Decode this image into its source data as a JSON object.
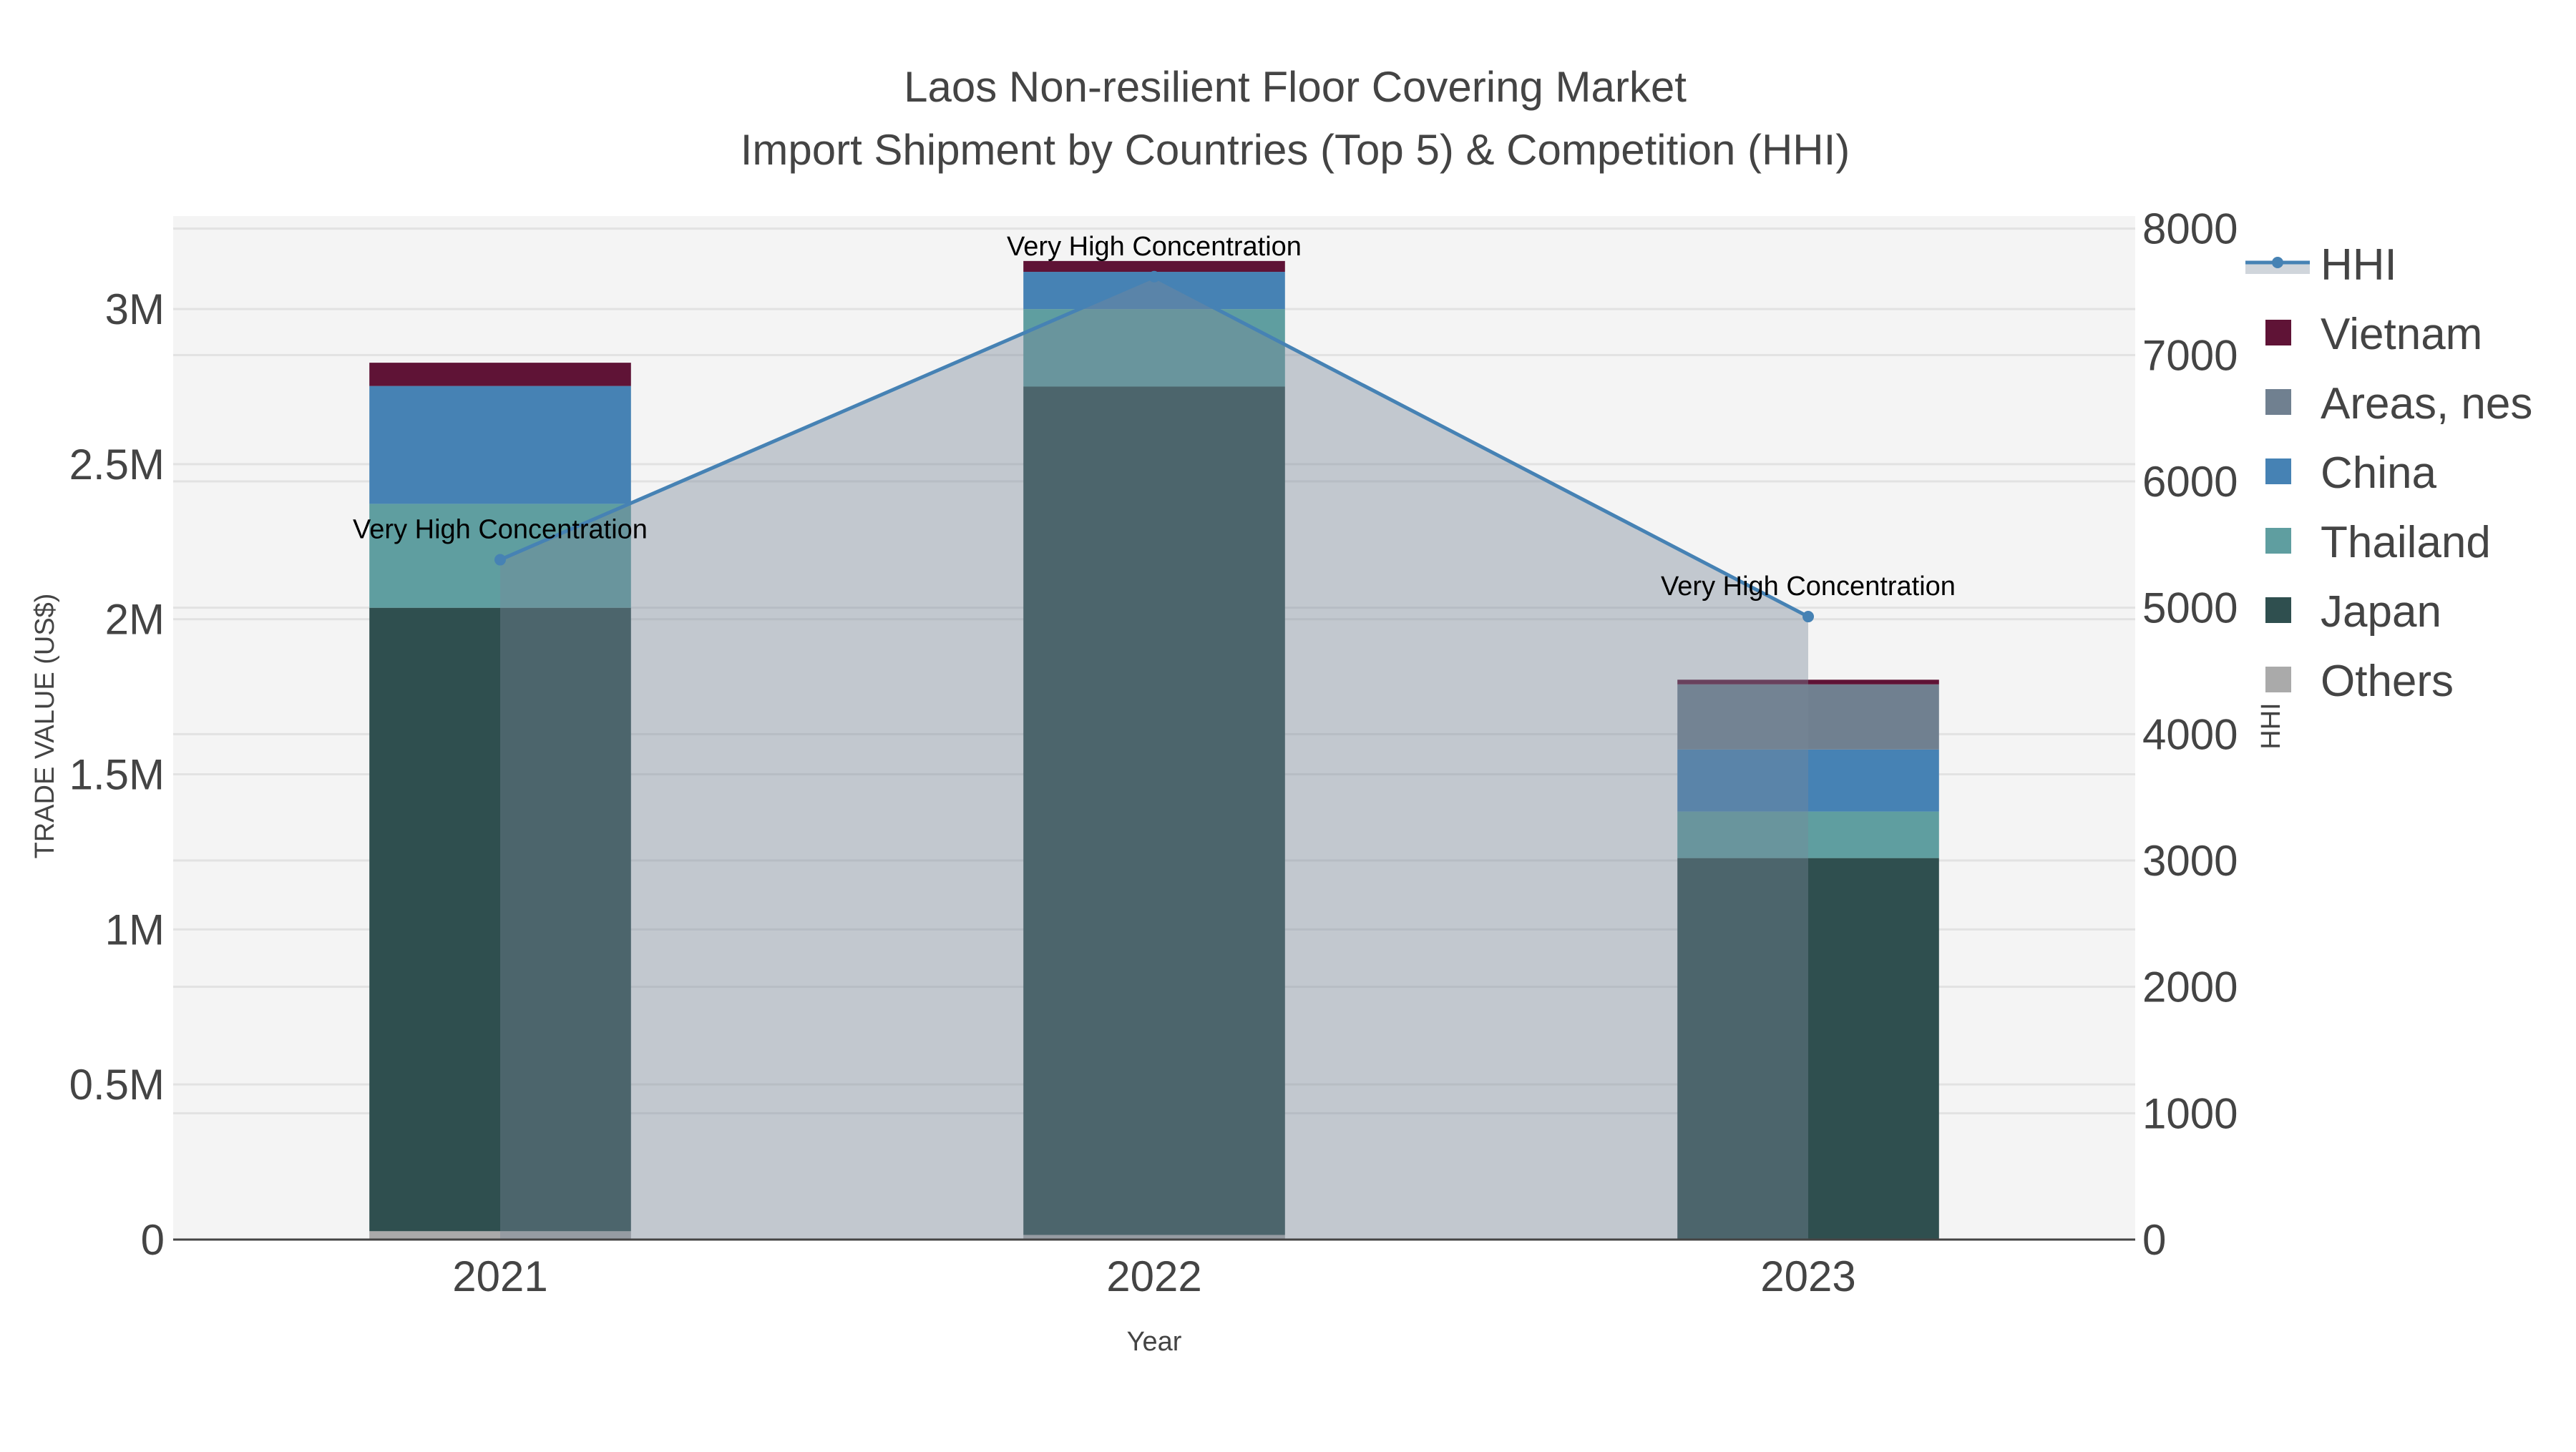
{
  "chart_data": {
    "type": "bar",
    "title": "Laos Non-resilient Floor Covering Market",
    "subtitle": "Import Shipment by Countries (Top 5) & Competition (HHI)",
    "xlabel": "Year",
    "ylabel": "TRADE VALUE (US$)",
    "y2label": "HHI",
    "categories": [
      "2021",
      "2022",
      "2023"
    ],
    "ylim": [
      0,
      3300000
    ],
    "y2lim": [
      0,
      8100
    ],
    "yticks": [
      {
        "v": 0,
        "label": "0"
      },
      {
        "v": 500000,
        "label": "0.5M"
      },
      {
        "v": 1000000,
        "label": "1M"
      },
      {
        "v": 1500000,
        "label": "1.5M"
      },
      {
        "v": 2000000,
        "label": "2M"
      },
      {
        "v": 2500000,
        "label": "2.5M"
      },
      {
        "v": 3000000,
        "label": "3M"
      }
    ],
    "y2ticks": [
      {
        "v": 0,
        "label": "0"
      },
      {
        "v": 1000,
        "label": "1000"
      },
      {
        "v": 2000,
        "label": "2000"
      },
      {
        "v": 3000,
        "label": "3000"
      },
      {
        "v": 4000,
        "label": "4000"
      },
      {
        "v": 5000,
        "label": "5000"
      },
      {
        "v": 6000,
        "label": "6000"
      },
      {
        "v": 7000,
        "label": "7000"
      },
      {
        "v": 8000,
        "label": "8000"
      }
    ],
    "stacked": true,
    "grid": true,
    "legend_position": "right",
    "series": [
      {
        "name": "Others",
        "color": "#aaaaaa",
        "values": [
          27000,
          15000,
          0
        ]
      },
      {
        "name": "Japan",
        "color": "#2f4f4f",
        "values": [
          2010000,
          2735000,
          1230000
        ]
      },
      {
        "name": "Thailand",
        "color": "#5f9ea0",
        "values": [
          335000,
          250000,
          150000
        ]
      },
      {
        "name": "China",
        "color": "#4682b4",
        "values": [
          380000,
          120000,
          200000
        ]
      },
      {
        "name": "Areas, nes",
        "color": "#708090",
        "values": [
          0,
          0,
          210000
        ]
      },
      {
        "name": "Vietnam",
        "color": "#5f1336",
        "values": [
          75000,
          35000,
          15000
        ]
      }
    ],
    "hhi": {
      "name": "HHI",
      "color": "#4682b4",
      "fill": "rgba(119,136,153,0.4)",
      "values": [
        5380,
        7620,
        4930
      ],
      "annotations": [
        "Very High Concentration",
        "Very High Concentration",
        "Very High Concentration"
      ]
    },
    "legend_order": [
      "HHI",
      "Vietnam",
      "Areas, nes",
      "China",
      "Thailand",
      "Japan",
      "Others"
    ]
  }
}
